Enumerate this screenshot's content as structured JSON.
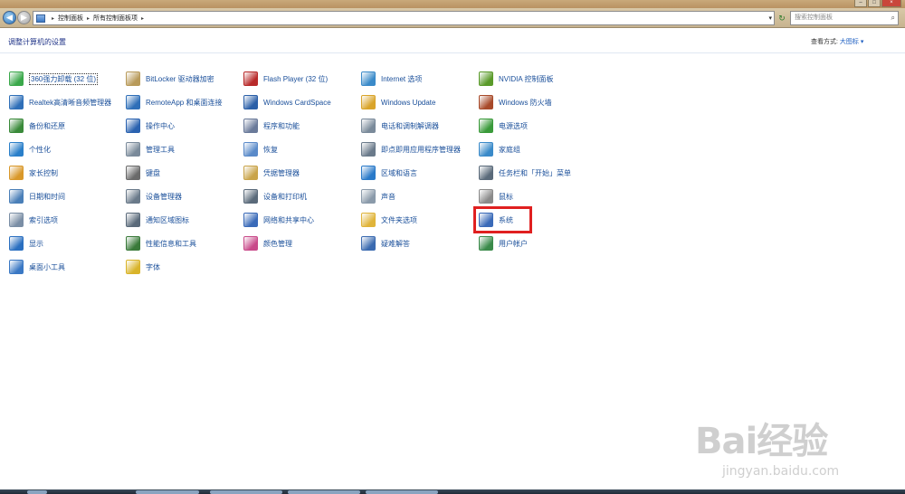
{
  "address": {
    "crumbs": [
      "控制面板",
      "所有控制面板项"
    ],
    "search_placeholder": "搜索控制面板"
  },
  "header": {
    "title": "调整计算机的设置",
    "view_by_label": "查看方式:",
    "view_by_value": "大图标 ▾"
  },
  "items": [
    {
      "label": "360强力卸载 (32 位)",
      "icon": "uninstall-icon",
      "color": "#3aa84a"
    },
    {
      "label": "Realtek高清晰音频管理器",
      "icon": "speaker-icon",
      "color": "#2f6fb8"
    },
    {
      "label": "备份和还原",
      "icon": "backup-icon",
      "color": "#3a8a3a"
    },
    {
      "label": "个性化",
      "icon": "personalize-icon",
      "color": "#2a7fc9"
    },
    {
      "label": "家长控制",
      "icon": "parental-icon",
      "color": "#d9982a"
    },
    {
      "label": "日期和时间",
      "icon": "clock-icon",
      "color": "#4a7fb8"
    },
    {
      "label": "索引选项",
      "icon": "magnifier-icon",
      "color": "#7a8ea5"
    },
    {
      "label": "显示",
      "icon": "monitor-icon",
      "color": "#2a6fc0"
    },
    {
      "label": "桌面小工具",
      "icon": "gadgets-icon",
      "color": "#3a78c4"
    },
    {
      "label": "BitLocker 驱动器加密",
      "icon": "key-icon",
      "color": "#b89a5a"
    },
    {
      "label": "RemoteApp 和桌面连接",
      "icon": "remote-icon",
      "color": "#2f6fb8"
    },
    {
      "label": "操作中心",
      "icon": "flag-icon",
      "color": "#2a62b0"
    },
    {
      "label": "管理工具",
      "icon": "tools-icon",
      "color": "#7a8a9a"
    },
    {
      "label": "键盘",
      "icon": "keyboard-icon",
      "color": "#6a6a6a"
    },
    {
      "label": "设备管理器",
      "icon": "device-manager-icon",
      "color": "#6a7a8a"
    },
    {
      "label": "通知区域图标",
      "icon": "notify-icon",
      "color": "#5a6a7a"
    },
    {
      "label": "性能信息和工具",
      "icon": "performance-icon",
      "color": "#3a7a3a"
    },
    {
      "label": "字体",
      "icon": "font-icon",
      "color": "#d9b42a"
    },
    {
      "label": "Flash Player (32 位)",
      "icon": "flash-icon",
      "color": "#b82a2a"
    },
    {
      "label": "Windows CardSpace",
      "icon": "cardspace-icon",
      "color": "#2a5fa8"
    },
    {
      "label": "程序和功能",
      "icon": "programs-icon",
      "color": "#6a7a9a"
    },
    {
      "label": "恢复",
      "icon": "recovery-icon",
      "color": "#5a8ac9"
    },
    {
      "label": "凭据管理器",
      "icon": "credential-icon",
      "color": "#c9a44a"
    },
    {
      "label": "设备和打印机",
      "icon": "printer-icon",
      "color": "#5a6a7a"
    },
    {
      "label": "网络和共享中心",
      "icon": "network-icon",
      "color": "#3a6ab8"
    },
    {
      "label": "颜色管理",
      "icon": "color-icon",
      "color": "#c94a8a"
    },
    {
      "label": "Internet 选项",
      "icon": "internet-icon",
      "color": "#3a8ac9"
    },
    {
      "label": "Windows Update",
      "icon": "update-icon",
      "color": "#d9a42a"
    },
    {
      "label": "电话和调制解调器",
      "icon": "phone-icon",
      "color": "#7a8a9a"
    },
    {
      "label": "即点即用应用程序管理器",
      "icon": "clicktorun-icon",
      "color": "#6a7a8a"
    },
    {
      "label": "区域和语言",
      "icon": "globe-icon",
      "color": "#2a7ac9"
    },
    {
      "label": "声音",
      "icon": "sound-icon",
      "color": "#8a9aaa"
    },
    {
      "label": "文件夹选项",
      "icon": "folder-icon",
      "color": "#e0b43a"
    },
    {
      "label": "疑难解答",
      "icon": "troubleshoot-icon",
      "color": "#3a6ab0"
    },
    {
      "label": "NVIDIA 控制面板",
      "icon": "nvidia-icon",
      "color": "#5a9a2a"
    },
    {
      "label": "Windows 防火墙",
      "icon": "firewall-icon",
      "color": "#a84a2a"
    },
    {
      "label": "电源选项",
      "icon": "power-icon",
      "color": "#3a9a3a"
    },
    {
      "label": "家庭组",
      "icon": "homegroup-icon",
      "color": "#3a8ac9"
    },
    {
      "label": "任务栏和「开始」菜单",
      "icon": "taskbar-icon",
      "color": "#5a6a7a"
    },
    {
      "label": "鼠标",
      "icon": "mouse-icon",
      "color": "#8a8a8a"
    },
    {
      "label": "系统",
      "icon": "system-icon",
      "color": "#3a6ab8"
    },
    {
      "label": "用户帐户",
      "icon": "users-icon",
      "color": "#3a8a4a"
    }
  ],
  "watermark": {
    "brand": "Bai经验",
    "url": "jingyan.baidu.com"
  }
}
